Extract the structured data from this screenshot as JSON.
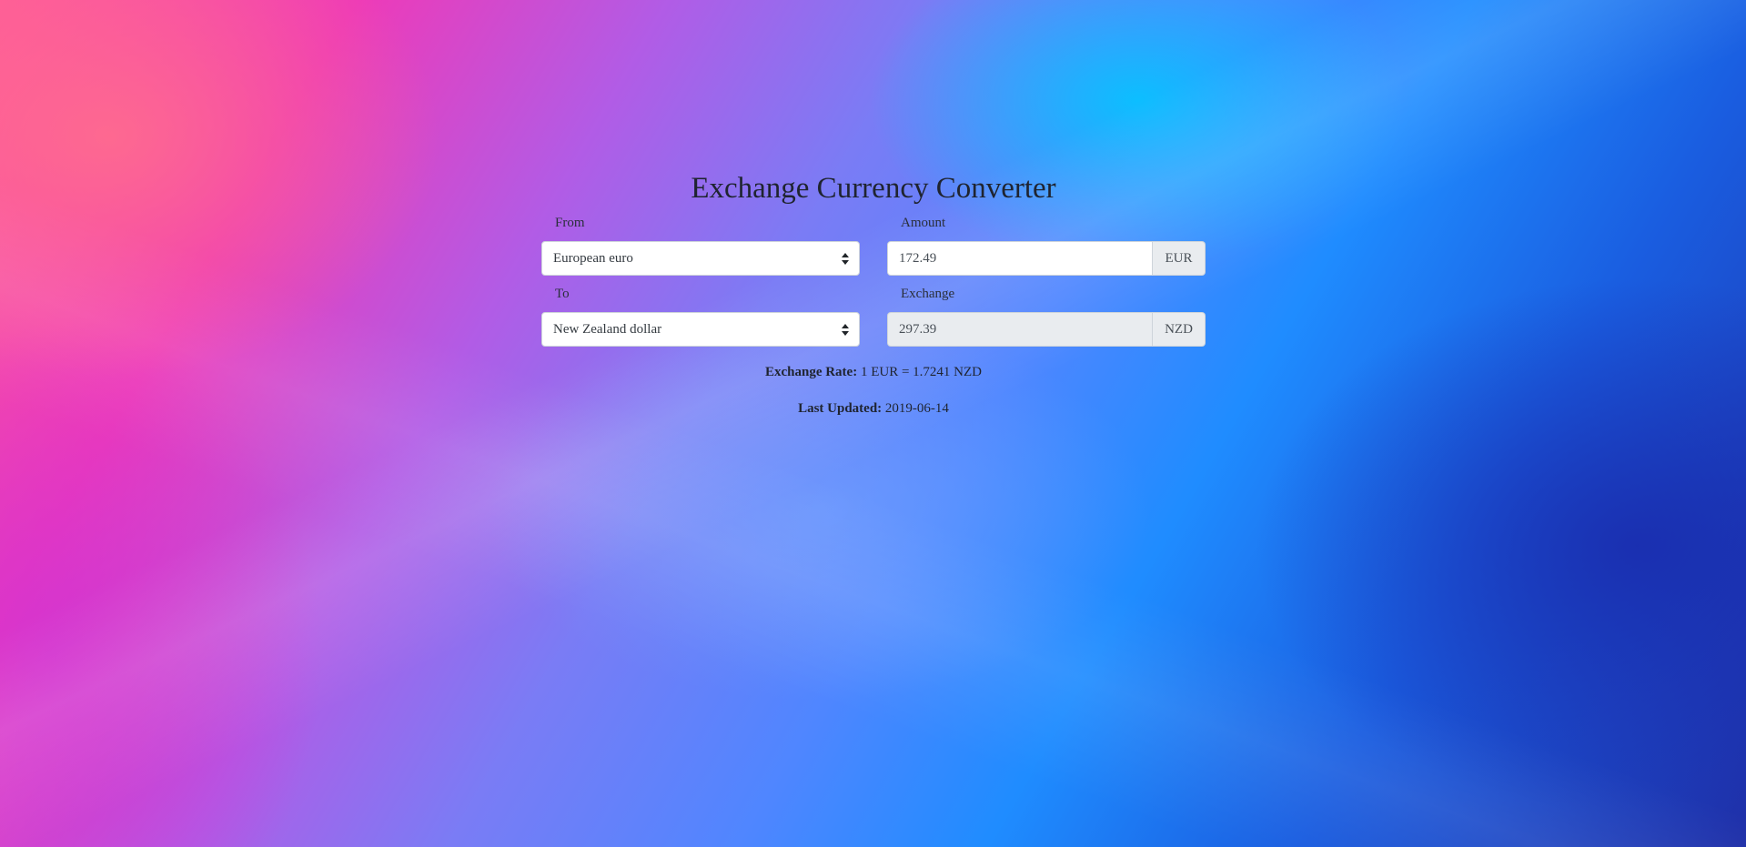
{
  "title": "Exchange Currency Converter",
  "from": {
    "label": "From",
    "selected": "European euro",
    "icon": "sort-caret-icon"
  },
  "amount": {
    "label": "Amount",
    "value": "172.49",
    "currency": "EUR"
  },
  "to": {
    "label": "To",
    "selected": "New Zealand dollar",
    "icon": "sort-caret-icon"
  },
  "exchange": {
    "label": "Exchange",
    "value": "297.39",
    "currency": "NZD"
  },
  "rate": {
    "label": "Exchange Rate:",
    "value": "1 EUR = 1.7241 NZD"
  },
  "updated": {
    "label": "Last Updated:",
    "value": "2019-06-14"
  },
  "colors": {
    "text": "#212529",
    "field_background": "#ffffff",
    "readonly_background": "#e9ecef",
    "border": "#ced4da"
  }
}
